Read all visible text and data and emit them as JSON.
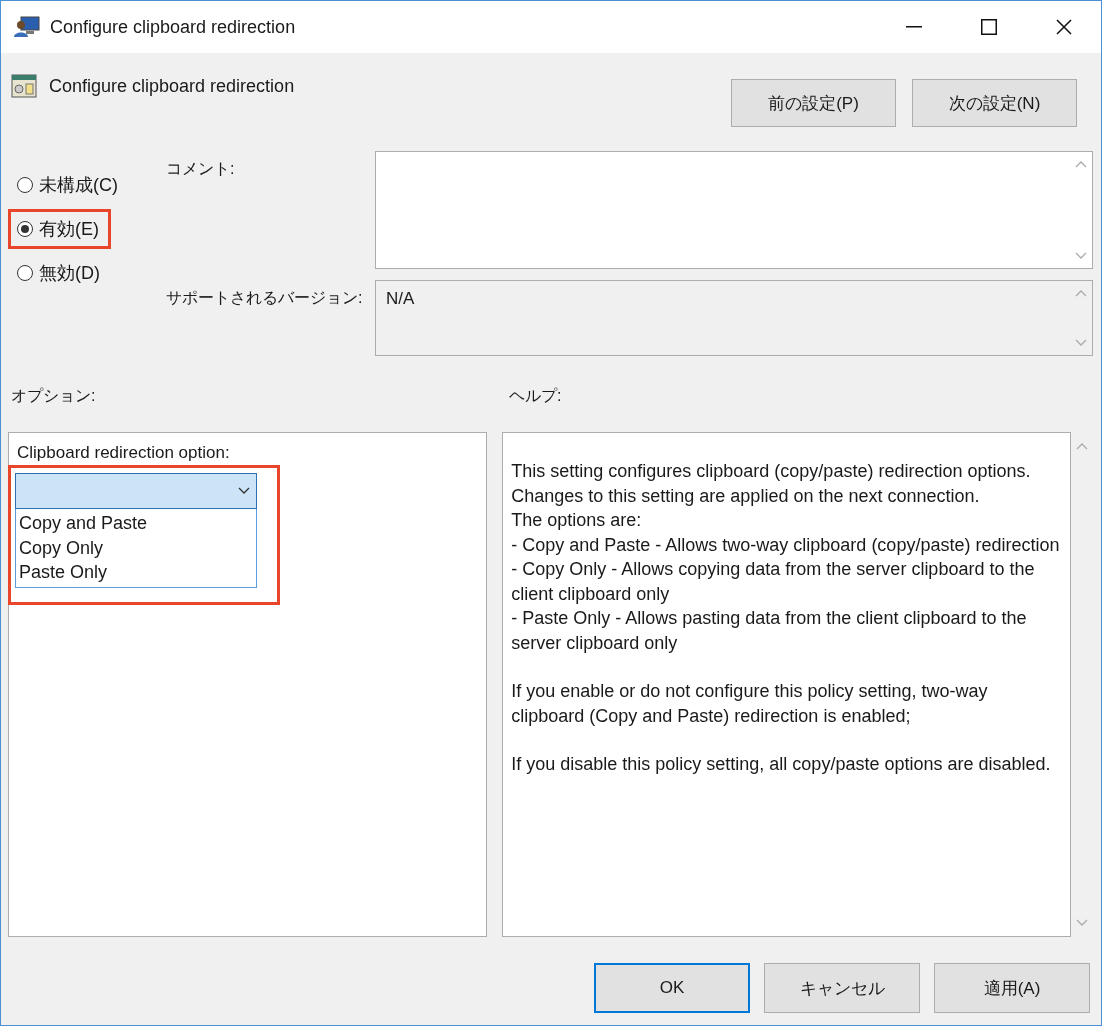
{
  "window": {
    "title": "Configure clipboard redirection"
  },
  "policy": {
    "title": "Configure clipboard redirection"
  },
  "nav_buttons": [
    "前の設定(P)",
    "次の設定(N)"
  ],
  "state_options": [
    {
      "label": "未構成(C)",
      "selected": false,
      "highlighted": false
    },
    {
      "label": "有効(E)",
      "selected": true,
      "highlighted": true
    },
    {
      "label": "無効(D)",
      "selected": false,
      "highlighted": false
    }
  ],
  "comment": {
    "label": "コメント:"
  },
  "supported": {
    "label": "サポートされるバージョン:",
    "value": "N/A"
  },
  "options": {
    "label": "オプション:",
    "field_label": "Clipboard redirection option:",
    "dropdown": {
      "expanded": true,
      "highlighted": true,
      "items": [
        "Copy and Paste",
        "Copy Only",
        "Paste Only"
      ]
    }
  },
  "help": {
    "label": "ヘルプ:",
    "paragraphs": [
      [
        "This setting configures clipboard (copy/paste) redirection options. Changes to this setting are applied on the next connection.",
        "The options are:",
        "- Copy and Paste - Allows two-way clipboard (copy/paste) redirection",
        "- Copy Only - Allows copying data from the server clipboard to the client clipboard only",
        "- Paste Only - Allows pasting data from the client clipboard to the server clipboard only"
      ],
      [
        "If you enable or do not configure this policy setting, two-way clipboard (Copy and Paste) redirection is enabled;"
      ],
      [
        "If you disable this policy setting, all copy/paste options are disabled."
      ]
    ]
  },
  "buttons": [
    {
      "label": "OK",
      "default": true
    },
    {
      "label": "キャンセル",
      "default": false
    },
    {
      "label": "適用(A)",
      "default": false
    }
  ]
}
